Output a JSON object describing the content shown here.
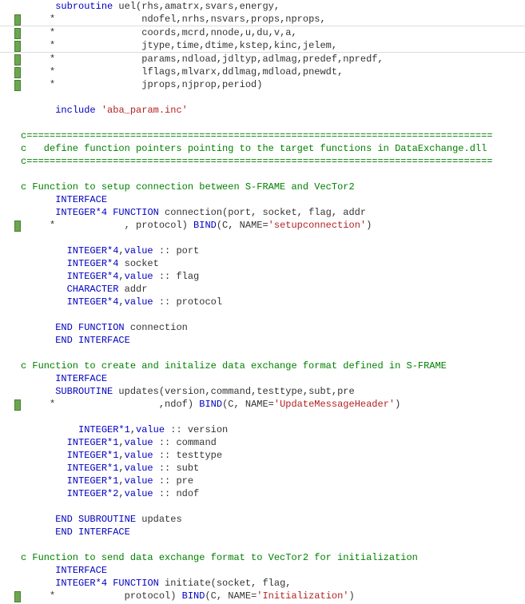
{
  "lines": [
    {
      "marker": false,
      "segs": [
        {
          "t": "      ",
          "c": "txt"
        },
        {
          "t": "subroutine",
          "c": "kw"
        },
        {
          "t": " uel(rhs,amatrx,svars,energy,",
          "c": "txt"
        }
      ]
    },
    {
      "marker": true,
      "segs": [
        {
          "t": "     *",
          "c": "txt"
        },
        {
          "t": "               ndofel,nrhs,nsvars,props,nprops,",
          "c": "txt"
        }
      ]
    },
    {
      "marker": true,
      "sep": "top",
      "segs": [
        {
          "t": "     *",
          "c": "txt"
        },
        {
          "t": "               coords,mcrd,nnode,u,du,v,a,",
          "c": "txt"
        }
      ]
    },
    {
      "marker": true,
      "sep": "bot",
      "segs": [
        {
          "t": "     *",
          "c": "txt"
        },
        {
          "t": "               jtype,time,dtime,kstep,kinc,jelem,",
          "c": "txt"
        }
      ]
    },
    {
      "marker": true,
      "segs": [
        {
          "t": "     *",
          "c": "txt"
        },
        {
          "t": "               params,ndload,jdltyp,adlmag,predef,npredf,",
          "c": "txt"
        }
      ]
    },
    {
      "marker": true,
      "segs": [
        {
          "t": "     *",
          "c": "txt"
        },
        {
          "t": "               lflags,mlvarx,ddlmag,mdload,pnewdt,",
          "c": "txt"
        }
      ]
    },
    {
      "marker": true,
      "segs": [
        {
          "t": "     *",
          "c": "txt"
        },
        {
          "t": "               jprops,njprop,period)",
          "c": "txt"
        }
      ]
    },
    {
      "marker": false,
      "segs": [
        {
          "t": " ",
          "c": "txt"
        }
      ]
    },
    {
      "marker": false,
      "segs": [
        {
          "t": "      ",
          "c": "txt"
        },
        {
          "t": "include",
          "c": "kw"
        },
        {
          "t": " ",
          "c": "txt"
        },
        {
          "t": "'aba_param.inc'",
          "c": "str"
        }
      ]
    },
    {
      "marker": false,
      "segs": [
        {
          "t": " ",
          "c": "txt"
        }
      ]
    },
    {
      "marker": false,
      "segs": [
        {
          "t": "c=================================================================================",
          "c": "com"
        }
      ]
    },
    {
      "marker": false,
      "segs": [
        {
          "t": "c   define function pointers pointing to the target functions in DataExchange.dll",
          "c": "com"
        }
      ]
    },
    {
      "marker": false,
      "segs": [
        {
          "t": "c=================================================================================",
          "c": "com"
        }
      ]
    },
    {
      "marker": false,
      "segs": [
        {
          "t": " ",
          "c": "txt"
        }
      ]
    },
    {
      "marker": false,
      "segs": [
        {
          "t": "c Function to setup connection between S-FRAME and VecTor2",
          "c": "com"
        }
      ]
    },
    {
      "marker": false,
      "segs": [
        {
          "t": "      ",
          "c": "txt"
        },
        {
          "t": "INTERFACE",
          "c": "kw"
        }
      ]
    },
    {
      "marker": false,
      "segs": [
        {
          "t": "      ",
          "c": "txt"
        },
        {
          "t": "INTEGER*4",
          "c": "kw"
        },
        {
          "t": " ",
          "c": "txt"
        },
        {
          "t": "FUNCTION",
          "c": "kw"
        },
        {
          "t": " connection(port, socket, flag, addr",
          "c": "txt"
        }
      ]
    },
    {
      "marker": true,
      "segs": [
        {
          "t": "     *",
          "c": "txt"
        },
        {
          "t": "            , protocol) ",
          "c": "txt"
        },
        {
          "t": "BIND",
          "c": "kw"
        },
        {
          "t": "(C, NAME=",
          "c": "txt"
        },
        {
          "t": "'setupconnection'",
          "c": "str"
        },
        {
          "t": ")",
          "c": "txt"
        }
      ]
    },
    {
      "marker": false,
      "segs": [
        {
          "t": " ",
          "c": "txt"
        }
      ]
    },
    {
      "marker": false,
      "segs": [
        {
          "t": "        ",
          "c": "txt"
        },
        {
          "t": "INTEGER*4",
          "c": "kw"
        },
        {
          "t": ",",
          "c": "txt"
        },
        {
          "t": "value",
          "c": "kw"
        },
        {
          "t": " :: port",
          "c": "txt"
        }
      ]
    },
    {
      "marker": false,
      "segs": [
        {
          "t": "        ",
          "c": "txt"
        },
        {
          "t": "INTEGER*4",
          "c": "kw"
        },
        {
          "t": " socket",
          "c": "txt"
        }
      ]
    },
    {
      "marker": false,
      "segs": [
        {
          "t": "        ",
          "c": "txt"
        },
        {
          "t": "INTEGER*4",
          "c": "kw"
        },
        {
          "t": ",",
          "c": "txt"
        },
        {
          "t": "value",
          "c": "kw"
        },
        {
          "t": " :: flag",
          "c": "txt"
        }
      ]
    },
    {
      "marker": false,
      "segs": [
        {
          "t": "        ",
          "c": "txt"
        },
        {
          "t": "CHARACTER",
          "c": "kw"
        },
        {
          "t": " addr",
          "c": "txt"
        }
      ]
    },
    {
      "marker": false,
      "segs": [
        {
          "t": "        ",
          "c": "txt"
        },
        {
          "t": "INTEGER*4",
          "c": "kw"
        },
        {
          "t": ",",
          "c": "txt"
        },
        {
          "t": "value",
          "c": "kw"
        },
        {
          "t": " :: protocol",
          "c": "txt"
        }
      ]
    },
    {
      "marker": false,
      "segs": [
        {
          "t": " ",
          "c": "txt"
        }
      ]
    },
    {
      "marker": false,
      "segs": [
        {
          "t": "      ",
          "c": "txt"
        },
        {
          "t": "END FUNCTION",
          "c": "kw"
        },
        {
          "t": " connection",
          "c": "txt"
        }
      ]
    },
    {
      "marker": false,
      "segs": [
        {
          "t": "      ",
          "c": "txt"
        },
        {
          "t": "END INTERFACE",
          "c": "kw"
        }
      ]
    },
    {
      "marker": false,
      "segs": [
        {
          "t": " ",
          "c": "txt"
        }
      ]
    },
    {
      "marker": false,
      "segs": [
        {
          "t": "c Function to create and initalize data exchange format defined in S-FRAME",
          "c": "com"
        }
      ]
    },
    {
      "marker": false,
      "segs": [
        {
          "t": "      ",
          "c": "txt"
        },
        {
          "t": "INTERFACE",
          "c": "kw"
        }
      ]
    },
    {
      "marker": false,
      "segs": [
        {
          "t": "      ",
          "c": "txt"
        },
        {
          "t": "SUBROUTINE",
          "c": "kw"
        },
        {
          "t": " updates(version,command,testtype,subt,pre",
          "c": "txt"
        }
      ]
    },
    {
      "marker": true,
      "segs": [
        {
          "t": "     *",
          "c": "txt"
        },
        {
          "t": "                  ,ndof) ",
          "c": "txt"
        },
        {
          "t": "BIND",
          "c": "kw"
        },
        {
          "t": "(C, NAME=",
          "c": "txt"
        },
        {
          "t": "'UpdateMessageHeader'",
          "c": "str"
        },
        {
          "t": ")",
          "c": "txt"
        }
      ]
    },
    {
      "marker": false,
      "segs": [
        {
          "t": " ",
          "c": "txt"
        }
      ]
    },
    {
      "marker": false,
      "segs": [
        {
          "t": "          ",
          "c": "txt"
        },
        {
          "t": "INTEGER*1",
          "c": "kw"
        },
        {
          "t": ",",
          "c": "txt"
        },
        {
          "t": "value",
          "c": "kw"
        },
        {
          "t": " :: version",
          "c": "txt"
        }
      ]
    },
    {
      "marker": false,
      "segs": [
        {
          "t": "        ",
          "c": "txt"
        },
        {
          "t": "INTEGER*1",
          "c": "kw"
        },
        {
          "t": ",",
          "c": "txt"
        },
        {
          "t": "value",
          "c": "kw"
        },
        {
          "t": " :: command",
          "c": "txt"
        }
      ]
    },
    {
      "marker": false,
      "segs": [
        {
          "t": "        ",
          "c": "txt"
        },
        {
          "t": "INTEGER*1",
          "c": "kw"
        },
        {
          "t": ",",
          "c": "txt"
        },
        {
          "t": "value",
          "c": "kw"
        },
        {
          "t": " :: testtype",
          "c": "txt"
        }
      ]
    },
    {
      "marker": false,
      "segs": [
        {
          "t": "        ",
          "c": "txt"
        },
        {
          "t": "INTEGER*1",
          "c": "kw"
        },
        {
          "t": ",",
          "c": "txt"
        },
        {
          "t": "value",
          "c": "kw"
        },
        {
          "t": " :: subt",
          "c": "txt"
        }
      ]
    },
    {
      "marker": false,
      "segs": [
        {
          "t": "        ",
          "c": "txt"
        },
        {
          "t": "INTEGER*1",
          "c": "kw"
        },
        {
          "t": ",",
          "c": "txt"
        },
        {
          "t": "value",
          "c": "kw"
        },
        {
          "t": " :: pre",
          "c": "txt"
        }
      ]
    },
    {
      "marker": false,
      "segs": [
        {
          "t": "        ",
          "c": "txt"
        },
        {
          "t": "INTEGER*2",
          "c": "kw"
        },
        {
          "t": ",",
          "c": "txt"
        },
        {
          "t": "value",
          "c": "kw"
        },
        {
          "t": " :: ndof",
          "c": "txt"
        }
      ]
    },
    {
      "marker": false,
      "segs": [
        {
          "t": " ",
          "c": "txt"
        }
      ]
    },
    {
      "marker": false,
      "segs": [
        {
          "t": "      ",
          "c": "txt"
        },
        {
          "t": "END SUBROUTINE",
          "c": "kw"
        },
        {
          "t": " updates",
          "c": "txt"
        }
      ]
    },
    {
      "marker": false,
      "segs": [
        {
          "t": "      ",
          "c": "txt"
        },
        {
          "t": "END INTERFACE",
          "c": "kw"
        }
      ]
    },
    {
      "marker": false,
      "segs": [
        {
          "t": " ",
          "c": "txt"
        }
      ]
    },
    {
      "marker": false,
      "segs": [
        {
          "t": "c Function to send data exchange format to VecTor2 for initialization",
          "c": "com"
        }
      ]
    },
    {
      "marker": false,
      "segs": [
        {
          "t": "      ",
          "c": "txt"
        },
        {
          "t": "INTERFACE",
          "c": "kw"
        }
      ]
    },
    {
      "marker": false,
      "segs": [
        {
          "t": "      ",
          "c": "txt"
        },
        {
          "t": "INTEGER*4",
          "c": "kw"
        },
        {
          "t": " ",
          "c": "txt"
        },
        {
          "t": "FUNCTION",
          "c": "kw"
        },
        {
          "t": " initiate(socket, flag,",
          "c": "txt"
        }
      ]
    },
    {
      "marker": true,
      "segs": [
        {
          "t": "     *",
          "c": "txt"
        },
        {
          "t": "            protocol) ",
          "c": "txt"
        },
        {
          "t": "BIND",
          "c": "kw"
        },
        {
          "t": "(C, NAME=",
          "c": "txt"
        },
        {
          "t": "'Initialization'",
          "c": "str"
        },
        {
          "t": ")",
          "c": "txt"
        }
      ]
    }
  ]
}
